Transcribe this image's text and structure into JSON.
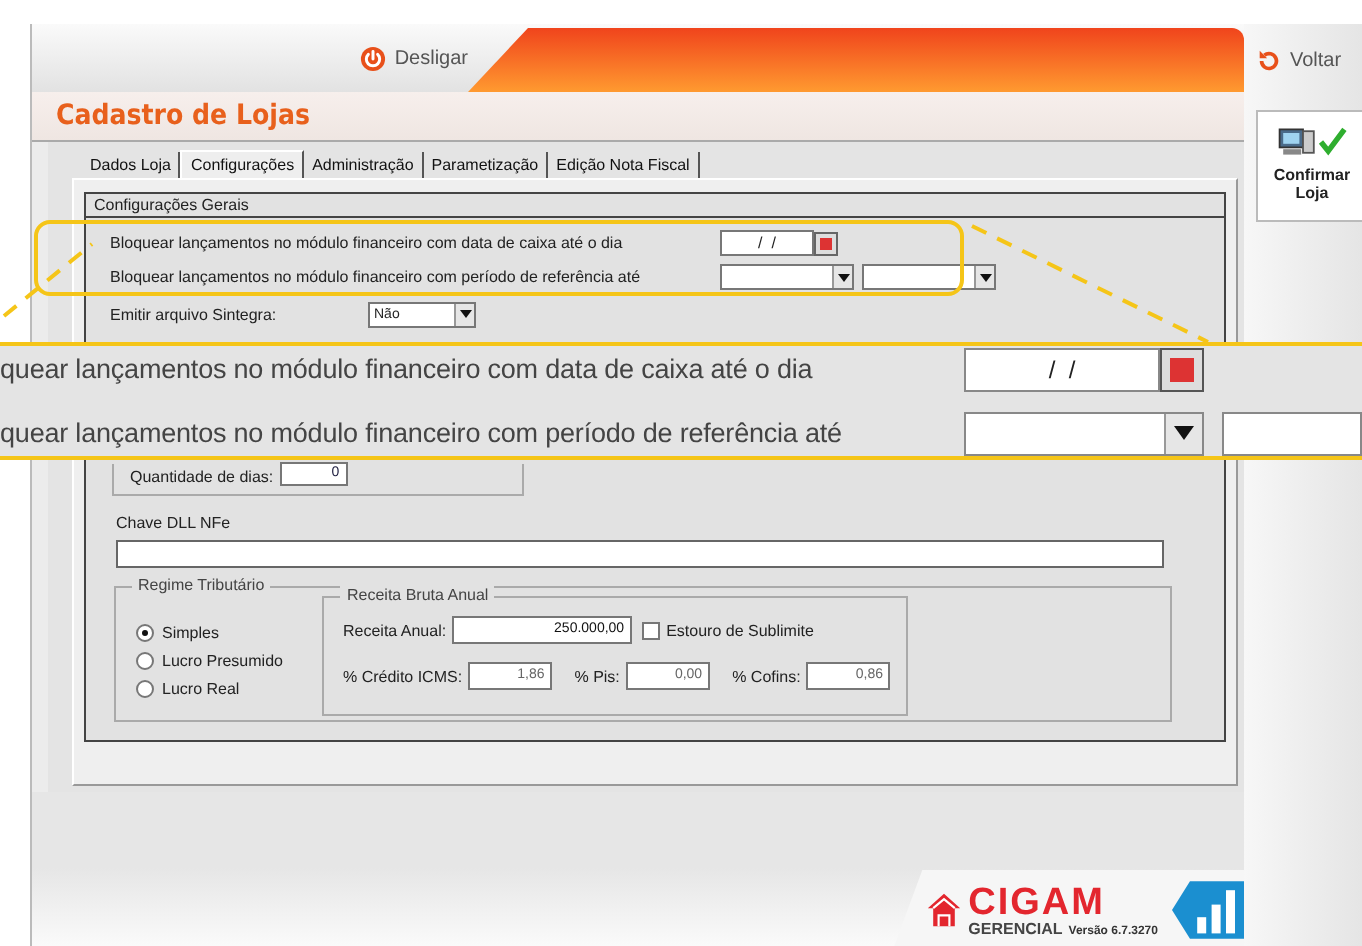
{
  "header": {
    "power_button": "Desligar",
    "back_button": "Voltar"
  },
  "title": "Cadastro de Lojas",
  "tabs": [
    {
      "label": "Dados Loja",
      "selected": false
    },
    {
      "label": "Configurações",
      "selected": true
    },
    {
      "label": "Administração",
      "selected": false
    },
    {
      "label": "Parametização",
      "selected": false
    },
    {
      "label": "Edição Nota Fiscal",
      "selected": false
    }
  ],
  "section_title": "Configurações Gerais",
  "lock_rows": [
    {
      "label": "Bloquear lançamentos no módulo financeiro com data de caixa até o dia",
      "kind": "date",
      "value": "/  /"
    },
    {
      "label": "Bloquear lançamentos no módulo financeiro com período de referência até",
      "kind": "period"
    }
  ],
  "sintegra": {
    "label": "Emitir arquivo Sintegra:",
    "value": "Não"
  },
  "days": {
    "label": "Quantidade de dias:",
    "value": "0"
  },
  "nfe_key": {
    "label": "Chave DLL NFe"
  },
  "regime": {
    "title": "Regime Tributário",
    "options": [
      {
        "label": "Simples",
        "selected": true
      },
      {
        "label": "Lucro Presumido",
        "selected": false
      },
      {
        "label": "Lucro Real",
        "selected": false
      }
    ]
  },
  "revenue": {
    "title": "Receita Bruta Anual",
    "annual_label": "Receita Anual:",
    "annual_value": "250.000,00",
    "overflow": {
      "label": "Estouro de Sublimite",
      "checked": false
    },
    "rates": [
      {
        "label": "% Crédito ICMS:",
        "value": "1,86"
      },
      {
        "label": "% Pis:",
        "value": "0,00"
      },
      {
        "label": "% Cofins:",
        "value": "0,86"
      }
    ]
  },
  "confirm_button": "Confirmar Loja",
  "callout": {
    "rows": [
      {
        "label": "quear lançamentos no módulo financeiro com data de caixa até o dia",
        "kind": "date",
        "value": "/  /"
      },
      {
        "label": "quear lançamentos no módulo financeiro com período de referência até",
        "kind": "period"
      }
    ]
  },
  "logo": {
    "brand": "CIGAM",
    "product": "GERENCIAL",
    "version": "Versão 6.7.3270"
  }
}
